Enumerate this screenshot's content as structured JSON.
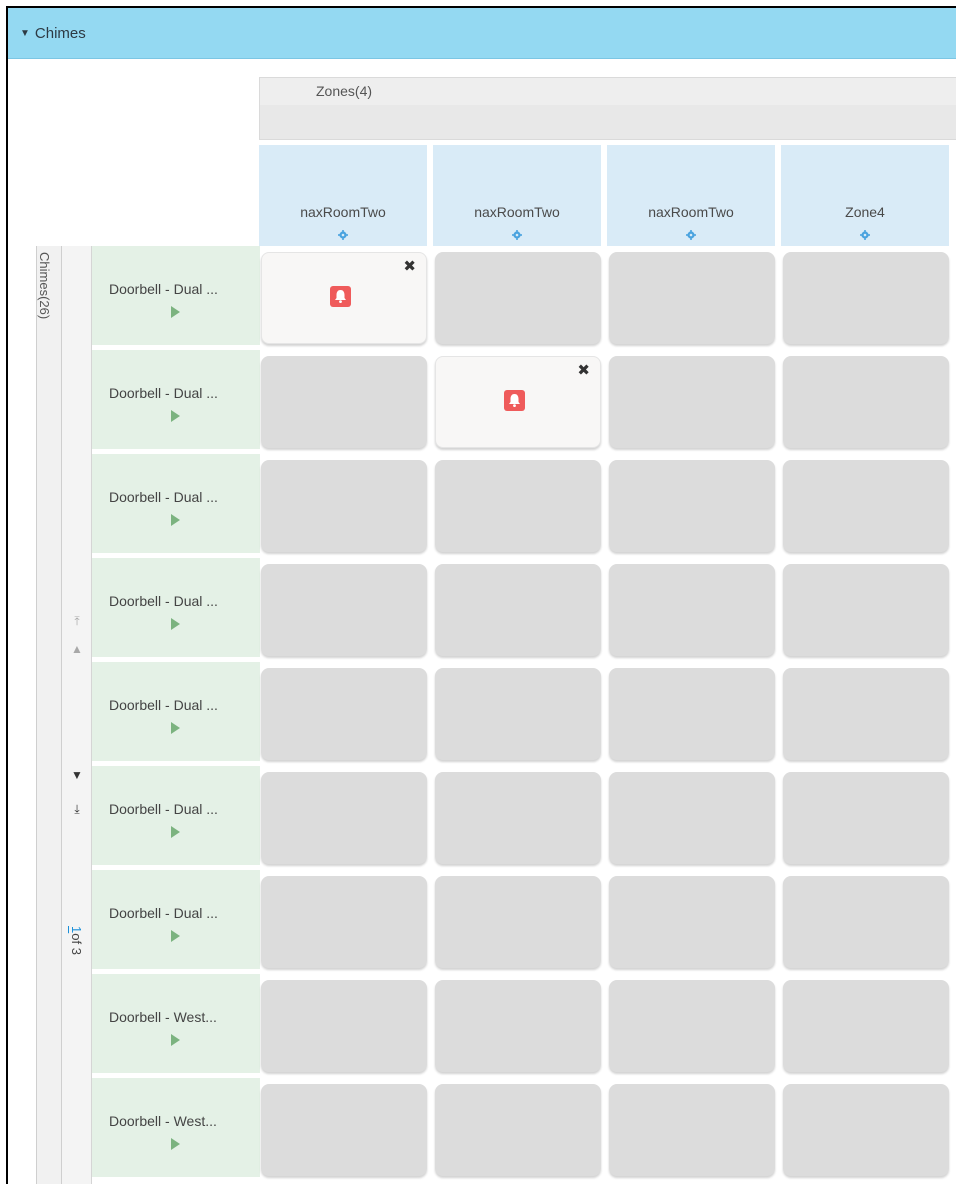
{
  "header": {
    "title": "Chimes"
  },
  "zones_header": "Zones(4)",
  "zones": [
    "naxRoomTwo",
    "naxRoomTwo",
    "naxRoomTwo",
    "Zone4"
  ],
  "side_label": "Chimes(26)",
  "pager": {
    "current": "1",
    "of_text": "of 3"
  },
  "rows": [
    "Doorbell - Dual ...",
    "Doorbell - Dual ...",
    "Doorbell - Dual ...",
    "Doorbell - Dual ...",
    "Doorbell - Dual ...",
    "Doorbell - Dual ...",
    "Doorbell - Dual ...",
    "Doorbell - West...",
    "Doorbell - West..."
  ],
  "assignments": [
    [
      0,
      0
    ],
    [
      1,
      1
    ]
  ],
  "colors": {
    "header": "#94d9f2",
    "zone_header": "#d9ebf7",
    "row_header": "#e4f1e6",
    "bell": "#ef5b5b"
  }
}
